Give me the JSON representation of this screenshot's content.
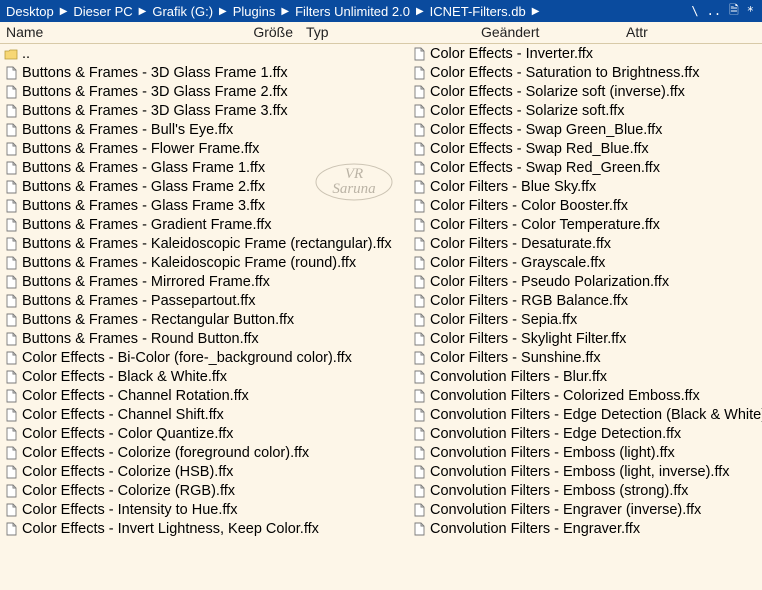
{
  "breadcrumb": {
    "segments": [
      "Desktop",
      "Dieser PC",
      "Grafik (G:)",
      "Plugins",
      "Filters Unlimited 2.0",
      "ICNET-Filters.db"
    ],
    "win_buttons": [
      "\\",
      "..",
      "🗎",
      "*"
    ]
  },
  "headers": {
    "name": "Name",
    "size": "Größe",
    "type": "Typ",
    "modified": "Geändert",
    "attr": "Attr"
  },
  "watermark": {
    "line1": "VR",
    "line2": "Saruna"
  },
  "left_column": [
    {
      "icon": "folder-up",
      "label": ".."
    },
    {
      "icon": "file",
      "label": "Buttons & Frames - 3D Glass Frame 1.ffx"
    },
    {
      "icon": "file",
      "label": "Buttons & Frames - 3D Glass Frame 2.ffx"
    },
    {
      "icon": "file",
      "label": "Buttons & Frames - 3D Glass Frame 3.ffx"
    },
    {
      "icon": "file",
      "label": "Buttons & Frames - Bull's Eye.ffx"
    },
    {
      "icon": "file",
      "label": "Buttons & Frames - Flower Frame.ffx"
    },
    {
      "icon": "file",
      "label": "Buttons & Frames - Glass Frame 1.ffx"
    },
    {
      "icon": "file",
      "label": "Buttons & Frames - Glass Frame 2.ffx"
    },
    {
      "icon": "file",
      "label": "Buttons & Frames - Glass Frame 3.ffx"
    },
    {
      "icon": "file",
      "label": "Buttons & Frames - Gradient Frame.ffx"
    },
    {
      "icon": "file",
      "label": "Buttons & Frames - Kaleidoscopic Frame (rectangular).ffx"
    },
    {
      "icon": "file",
      "label": "Buttons & Frames - Kaleidoscopic Frame (round).ffx"
    },
    {
      "icon": "file",
      "label": "Buttons & Frames - Mirrored Frame.ffx"
    },
    {
      "icon": "file",
      "label": "Buttons & Frames - Passepartout.ffx"
    },
    {
      "icon": "file",
      "label": "Buttons & Frames - Rectangular Button.ffx"
    },
    {
      "icon": "file",
      "label": "Buttons & Frames - Round Button.ffx"
    },
    {
      "icon": "file",
      "label": "Color Effects - Bi-Color (fore-_background color).ffx"
    },
    {
      "icon": "file",
      "label": "Color Effects - Black & White.ffx"
    },
    {
      "icon": "file",
      "label": "Color Effects - Channel Rotation.ffx"
    },
    {
      "icon": "file",
      "label": "Color Effects - Channel Shift.ffx"
    },
    {
      "icon": "file",
      "label": "Color Effects - Color Quantize.ffx"
    },
    {
      "icon": "file",
      "label": "Color Effects - Colorize (foreground color).ffx"
    },
    {
      "icon": "file",
      "label": "Color Effects - Colorize (HSB).ffx"
    },
    {
      "icon": "file",
      "label": "Color Effects - Colorize (RGB).ffx"
    },
    {
      "icon": "file",
      "label": "Color Effects - Intensity to Hue.ffx"
    },
    {
      "icon": "file",
      "label": "Color Effects - Invert Lightness, Keep Color.ffx"
    }
  ],
  "right_column": [
    {
      "icon": "file",
      "label": "Color Effects - Inverter.ffx"
    },
    {
      "icon": "file",
      "label": "Color Effects - Saturation to Brightness.ffx"
    },
    {
      "icon": "file",
      "label": "Color Effects - Solarize soft (inverse).ffx"
    },
    {
      "icon": "file",
      "label": "Color Effects - Solarize soft.ffx"
    },
    {
      "icon": "file",
      "label": "Color Effects - Swap Green_Blue.ffx"
    },
    {
      "icon": "file",
      "label": "Color Effects - Swap Red_Blue.ffx"
    },
    {
      "icon": "file",
      "label": "Color Effects - Swap Red_Green.ffx"
    },
    {
      "icon": "file",
      "label": "Color Filters - Blue Sky.ffx"
    },
    {
      "icon": "file",
      "label": "Color Filters - Color Booster.ffx"
    },
    {
      "icon": "file",
      "label": "Color Filters - Color Temperature.ffx"
    },
    {
      "icon": "file",
      "label": "Color Filters - Desaturate.ffx"
    },
    {
      "icon": "file",
      "label": "Color Filters - Grayscale.ffx"
    },
    {
      "icon": "file",
      "label": "Color Filters - Pseudo Polarization.ffx"
    },
    {
      "icon": "file",
      "label": "Color Filters - RGB Balance.ffx"
    },
    {
      "icon": "file",
      "label": "Color Filters - Sepia.ffx"
    },
    {
      "icon": "file",
      "label": "Color Filters - Skylight Filter.ffx"
    },
    {
      "icon": "file",
      "label": "Color Filters - Sunshine.ffx"
    },
    {
      "icon": "file",
      "label": "Convolution Filters - Blur.ffx"
    },
    {
      "icon": "file",
      "label": "Convolution Filters - Colorized Emboss.ffx"
    },
    {
      "icon": "file",
      "label": "Convolution Filters - Edge Detection (Black & White).ffx"
    },
    {
      "icon": "file",
      "label": "Convolution Filters - Edge Detection.ffx"
    },
    {
      "icon": "file",
      "label": "Convolution Filters - Emboss (light).ffx"
    },
    {
      "icon": "file",
      "label": "Convolution Filters - Emboss (light, inverse).ffx"
    },
    {
      "icon": "file",
      "label": "Convolution Filters - Emboss (strong).ffx"
    },
    {
      "icon": "file",
      "label": "Convolution Filters - Engraver (inverse).ffx"
    },
    {
      "icon": "file",
      "label": "Convolution Filters - Engraver.ffx"
    }
  ]
}
